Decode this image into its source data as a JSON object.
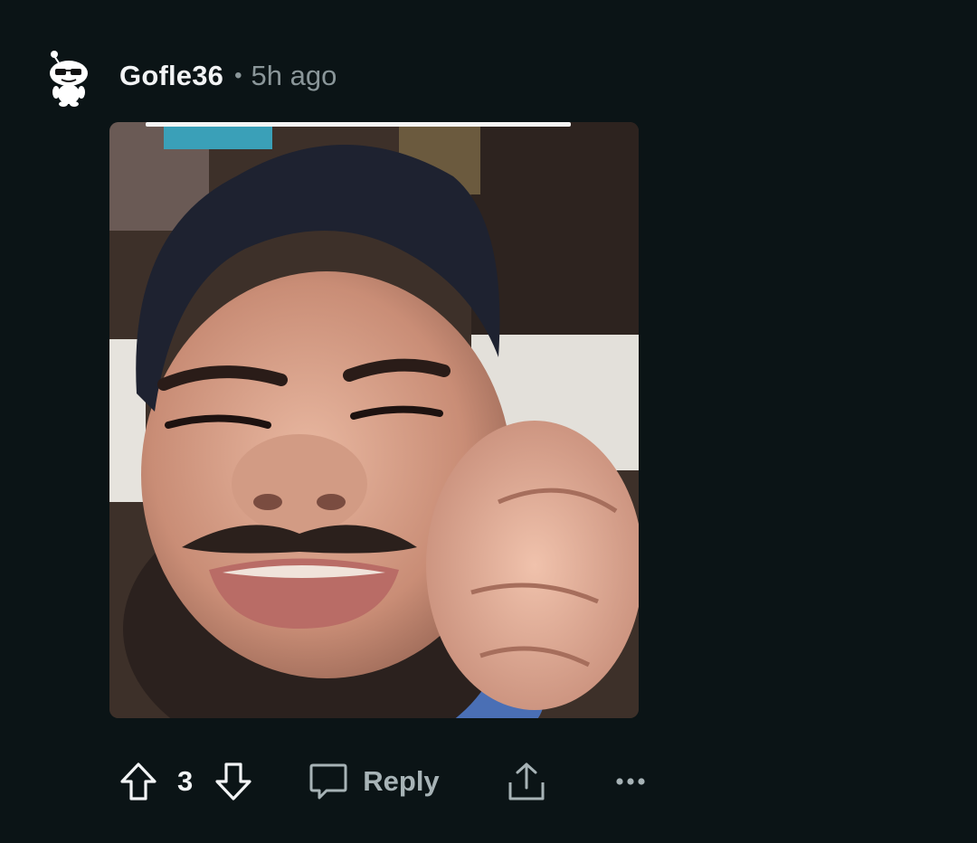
{
  "comment": {
    "author": "Gofle36",
    "separator": "•",
    "timestamp": "5h ago",
    "avatar_icon": "snoo-with-sunglasses-icon",
    "media": {
      "kind": "gif",
      "alt_icon": "laughing-man-gif"
    },
    "actions": {
      "upvote_icon": "arrow-up-icon",
      "score": "3",
      "downvote_icon": "arrow-down-icon",
      "reply_icon": "speech-bubble-icon",
      "reply_label": "Reply",
      "share_icon": "share-upload-icon",
      "more_icon": "ellipsis-icon"
    }
  },
  "colors": {
    "background": "#0b1416",
    "text_primary": "#f2f4f5",
    "text_muted": "#8a9699",
    "action_text": "#a7b3b6"
  }
}
